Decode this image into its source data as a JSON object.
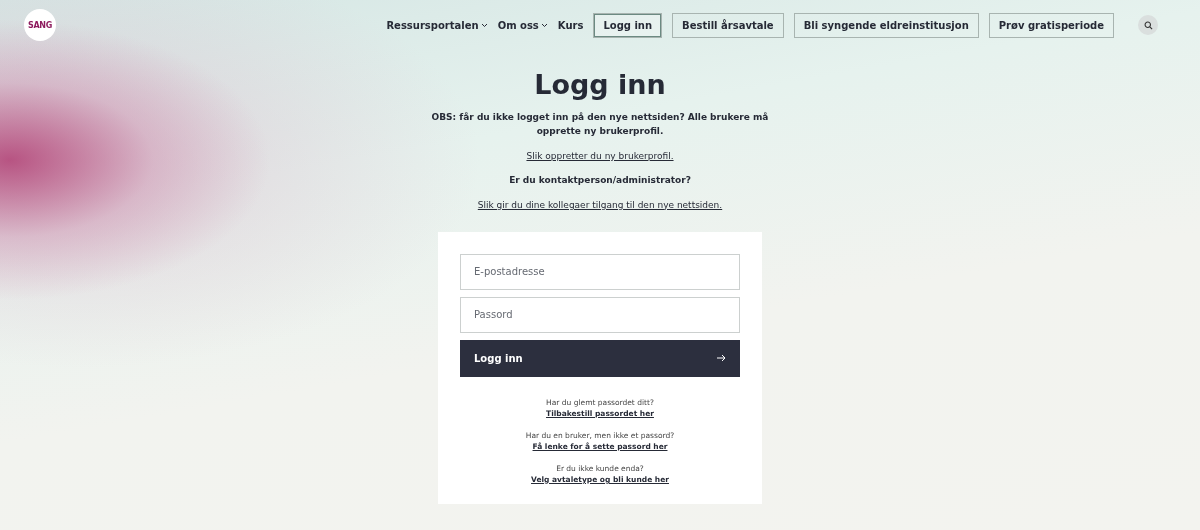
{
  "logo": {
    "text": "SANG"
  },
  "nav": [
    {
      "label": "Ressursportalen",
      "kind": "dropdown"
    },
    {
      "label": "Om oss",
      "kind": "dropdown"
    },
    {
      "label": "Kurs",
      "kind": "link"
    },
    {
      "label": "Logg inn",
      "kind": "button",
      "selected": true
    },
    {
      "label": "Bestill årsavtale",
      "kind": "button",
      "selected": false
    },
    {
      "label": "Bli syngende eldreinstitusjon",
      "kind": "button",
      "selected": false
    },
    {
      "label": "Prøv gratisperiode",
      "kind": "button",
      "selected": false
    }
  ],
  "title": "Logg inn",
  "intro": [
    {
      "kind": "notice",
      "text": "OBS: får du ikke logget inn på den nye nettsiden? Alle brukere må opprette ny brukerprofil."
    },
    {
      "kind": "link",
      "text": "Slik oppretter du ny brukerprofil."
    },
    {
      "kind": "heading",
      "text": "Er du kontaktperson/administrator?"
    },
    {
      "kind": "link",
      "text": "Slik gir du dine kollegaer tilgang til den nye nettsiden."
    }
  ],
  "form": {
    "email": {
      "placeholder": "E-postadresse"
    },
    "password": {
      "placeholder": "Passord"
    },
    "submit": "Logg inn"
  },
  "help": [
    {
      "question": "Har du glemt passordet ditt?",
      "link": "Tilbakestill passordet her"
    },
    {
      "question": "Har du en bruker, men ikke et passord?",
      "link": "Få lenke for å sette passord her"
    },
    {
      "question": "Er du ikke kunde enda?",
      "link": "Velg avtaletype og bli kunde her"
    }
  ]
}
